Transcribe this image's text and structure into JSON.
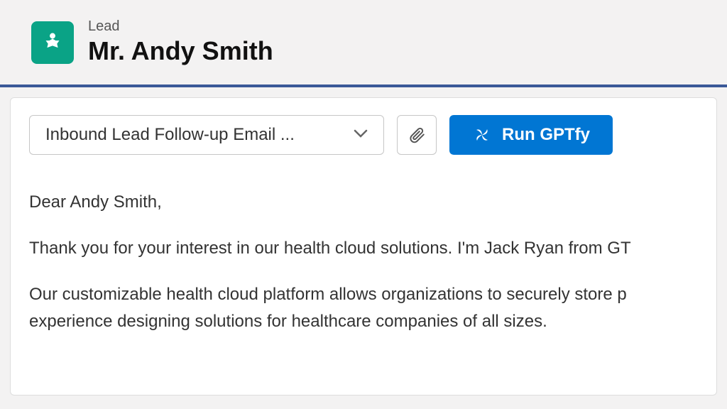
{
  "header": {
    "record_type": "Lead",
    "record_name": "Mr. Andy Smith",
    "icon": "person-star-icon"
  },
  "toolbar": {
    "template_selected": "Inbound Lead Follow-up Email ...",
    "attach_icon": "paperclip-icon",
    "run_icon": "pinwheel-icon",
    "run_label": "Run GPTfy"
  },
  "email": {
    "greeting": "Dear Andy Smith,",
    "p1": "Thank you for your interest in our health cloud solutions. I'm Jack Ryan from GT",
    "p2a": "Our customizable health cloud platform allows organizations to securely store p",
    "p2b": "experience designing solutions for healthcare companies of all sizes."
  },
  "colors": {
    "brand_teal": "#0aa386",
    "primary_blue": "#0176d3",
    "header_border": "#3b5998"
  }
}
